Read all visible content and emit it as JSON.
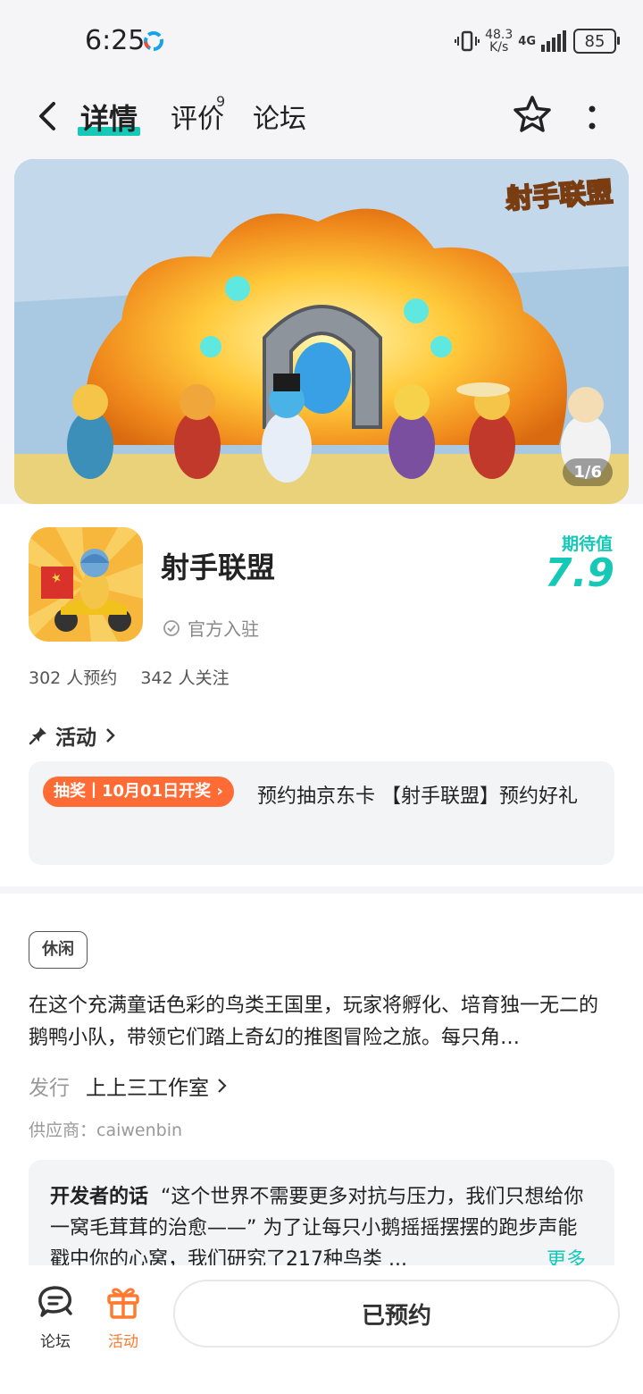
{
  "status_bar": {
    "time": "6:25",
    "net_speed_top": "48.3",
    "net_speed_bottom": "K/s",
    "network": "4G",
    "battery": "85"
  },
  "nav": {
    "tabs": [
      {
        "label": "详情",
        "active": true
      },
      {
        "label": "评价",
        "badge": "9"
      },
      {
        "label": "论坛"
      }
    ]
  },
  "banner": {
    "counter": "1/6",
    "logo_text": "射手联盟"
  },
  "game": {
    "name": "射手联盟",
    "official_label": "官方入驻",
    "expect_label": "期待值",
    "expect_score": "7.9",
    "reservations": "302 人预约",
    "followers": "342 人关注"
  },
  "activity": {
    "heading": "活动",
    "tag": "抽奖丨10月01日开奖",
    "text": "预约抽京东卡 【射手联盟】预约好礼"
  },
  "info": {
    "tag": "休闲",
    "description": "在这个充满童话色彩的鸟类王国里，玩家将孵化、培育独一无二的鹅鸭小队，带领它们踏上奇幻的推图冒险之旅。每只角…",
    "publisher_label": "发行",
    "publisher_name": "上上三工作室",
    "supplier": "供应商：caiwenbin",
    "dev_title": "开发者的话",
    "dev_text": "“这个世界不需要更多对抗与压力，我们只想给你一窝毛茸茸的治愈——” 为了让每只小鹅摇摇摆摆的跑步声能戳中你的心窝，我们研究了217种鸟类 ...",
    "more": "更多"
  },
  "bottom_bar": {
    "forum": "论坛",
    "activity": "活动",
    "reserved": "已预约"
  },
  "colors": {
    "accent": "#16c8b6",
    "lottery": "#ff6b35",
    "activity_icon": "#ff7a30"
  }
}
